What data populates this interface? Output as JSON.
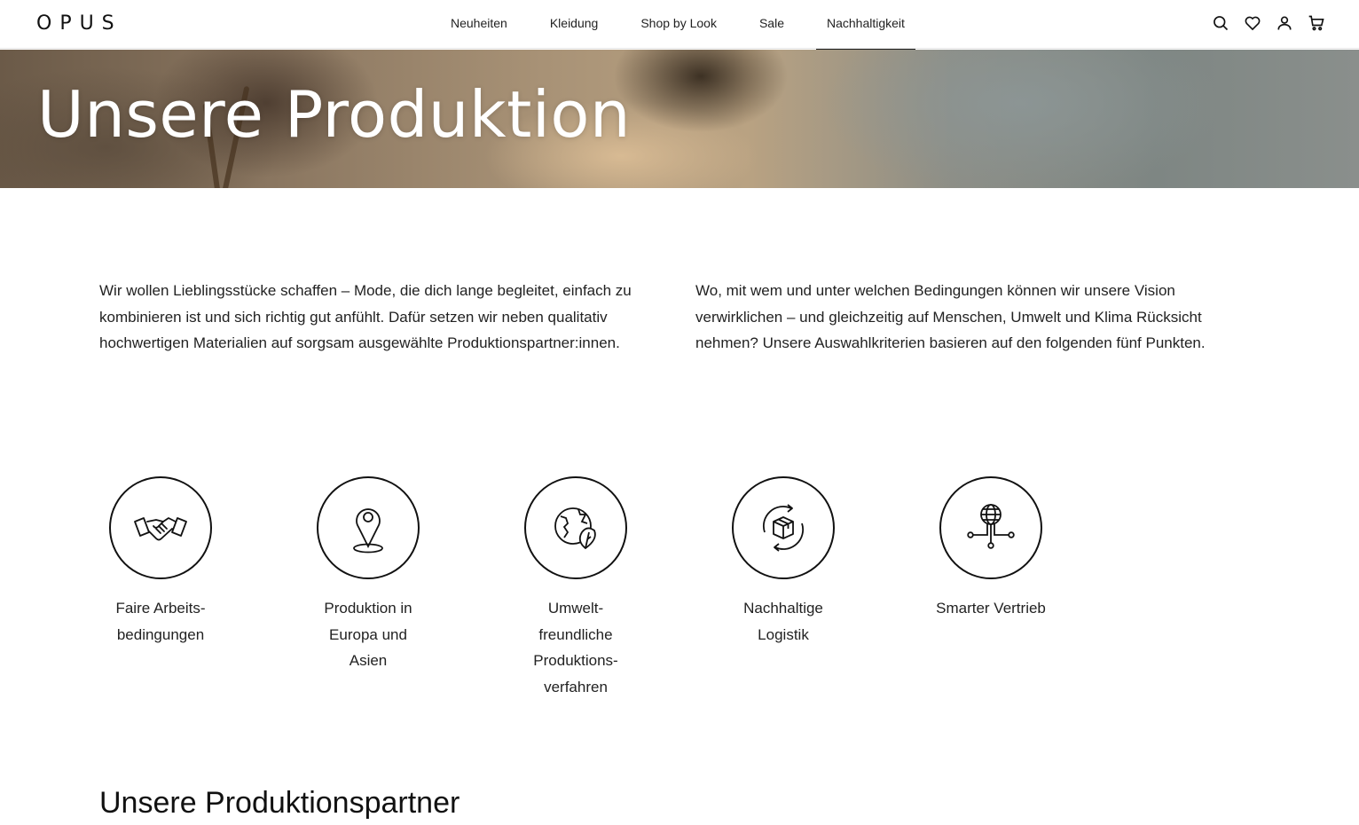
{
  "header": {
    "logo": "OPUS",
    "nav": [
      {
        "label": "Neuheiten"
      },
      {
        "label": "Kleidung"
      },
      {
        "label": "Shop by Look"
      },
      {
        "label": "Sale"
      },
      {
        "label": "Nachhaltigkeit",
        "active": true
      }
    ],
    "icons": [
      "search-icon",
      "heart-icon",
      "user-icon",
      "cart-icon"
    ]
  },
  "hero": {
    "title": "Unsere Produktion"
  },
  "intro": {
    "left": "Wir wollen Lieblingsstücke schaffen – Mode, die dich lange begleitet, einfach zu kombinieren ist und sich richtig gut anfühlt. Dafür setzen wir neben qualitativ hochwertigen Materialien auf sorgsam ausgewählte Produktionspartner:innen.",
    "right": "Wo, mit wem und unter welchen Bedingungen können wir unsere Vision verwirklichen – und gleichzeitig auf Menschen, Umwelt und Klima Rücksicht nehmen? Unsere Auswahlkriterien basieren auf den folgenden fünf Punkten."
  },
  "features": [
    {
      "icon": "handshake-icon",
      "label": "Faire Arbeits-\nbedingungen"
    },
    {
      "icon": "location-pin-icon",
      "label": "Produktion in\nEuropa und\nAsien"
    },
    {
      "icon": "globe-leaf-icon",
      "label": "Umwelt-\nfreundliche\nProduktions-\nverfahren"
    },
    {
      "icon": "box-recycle-icon",
      "label": "Nachhaltige\nLogistik"
    },
    {
      "icon": "globe-network-icon",
      "label": "Smarter Vertrieb"
    }
  ],
  "section": {
    "title": "Unsere Produktionspartner"
  },
  "colors": {
    "text": "#1a1a1a",
    "hero_text": "#ffffff",
    "border": "#111111"
  }
}
